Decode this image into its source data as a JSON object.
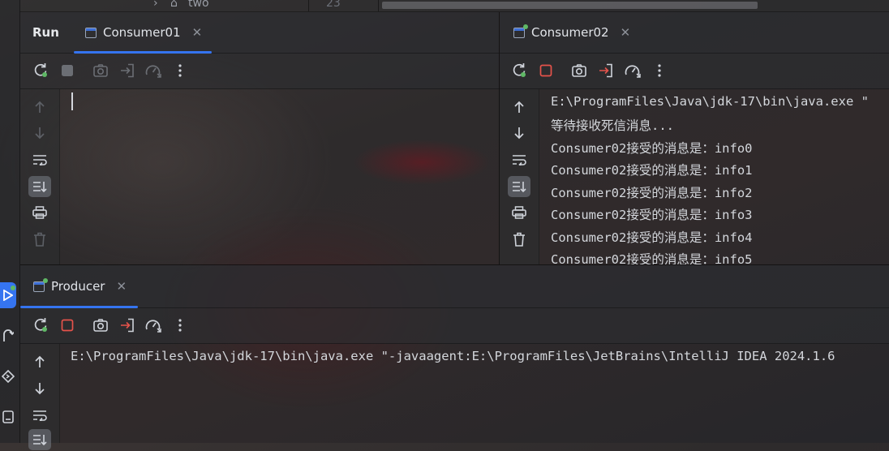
{
  "top_strip": {
    "tree_node": "two",
    "line_number": "23"
  },
  "run_panel": {
    "title": "Run",
    "tabs": [
      {
        "label": "Consumer01"
      }
    ],
    "console_lines": []
  },
  "consumer02_panel": {
    "tabs": [
      {
        "label": "Consumer02"
      }
    ],
    "console_lines": [
      "E:\\ProgramFiles\\Java\\jdk-17\\bin\\java.exe \"",
      "等待接收死信消息...",
      "Consumer02接受的消息是：info0",
      "Consumer02接受的消息是：info1",
      "Consumer02接受的消息是：info2",
      "Consumer02接受的消息是：info3",
      "Consumer02接受的消息是：info4",
      "Consumer02接受的消息是：info5"
    ]
  },
  "producer_panel": {
    "tabs": [
      {
        "label": "Producer"
      }
    ],
    "console_lines": [
      "E:\\ProgramFiles\\Java\\jdk-17\\bin\\java.exe \"-javaagent:E:\\ProgramFiles\\JetBrains\\IntelliJ IDEA 2024.1.6"
    ]
  },
  "icons": {
    "rerun": "rerun-icon",
    "stop": "stop-icon",
    "screenshot": "camera-icon",
    "exit": "exit-icon",
    "profiler": "gauge-icon",
    "more": "more-vertical-icon",
    "up": "arrow-up-icon",
    "down": "arrow-down-icon",
    "wrap": "soft-wrap-icon",
    "scroll_end": "scroll-to-end-icon",
    "print": "print-icon",
    "clear": "trash-icon"
  },
  "colors": {
    "accent": "#3574f0",
    "stop_active": "#e5534b",
    "running_dot": "#5fb865",
    "rerun_green": "#5fb865"
  }
}
